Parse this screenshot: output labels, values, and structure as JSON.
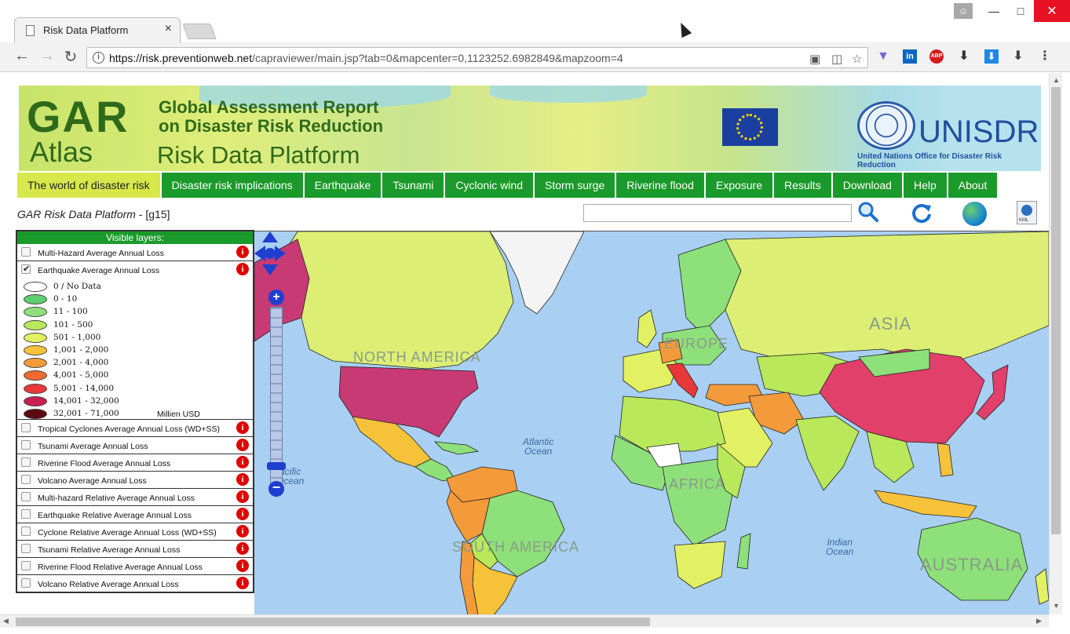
{
  "browser": {
    "tab_title": "Risk Data Platform",
    "tab_close": "×",
    "url_host": "https://risk.preventionweb.net",
    "url_path": "/capraviewer/main.jsp?tab=0&mapcenter=0,1123252.6982849&mapzoom=4",
    "ext_abp": "ABP",
    "ext_in": "in"
  },
  "banner": {
    "logo": "GAR",
    "atlas": "Atlas",
    "report_line1": "Global Assessment Report",
    "report_line2": "on Disaster Risk Reduction",
    "platform": "Risk Data Platform",
    "org": "UNISDR",
    "org_sub": "United Nations Office for Disaster Risk Reduction"
  },
  "menu": [
    {
      "label": "The world of disaster risk",
      "active": true
    },
    {
      "label": "Disaster risk implications"
    },
    {
      "label": "Earthquake"
    },
    {
      "label": "Tsunami"
    },
    {
      "label": "Cyclonic wind"
    },
    {
      "label": "Storm surge"
    },
    {
      "label": "Riverine flood"
    },
    {
      "label": "Exposure"
    },
    {
      "label": "Results"
    },
    {
      "label": "Download"
    },
    {
      "label": "Help"
    },
    {
      "label": "About"
    }
  ],
  "subhead": {
    "title": "GAR Risk Data Platform",
    "suffix": " - [g15]"
  },
  "search": {
    "placeholder": ""
  },
  "layers": {
    "header": "Visible layers:",
    "info_glyph": "i",
    "items": [
      {
        "label": "Multi-Hazard Average Annual Loss",
        "checked": false
      },
      {
        "label": "Earthquake Average Annual Loss",
        "checked": true
      },
      {
        "label": "Tropical Cyclones Average Annual Loss (WD+SS)",
        "checked": false
      },
      {
        "label": "Tsunami Average Annual Loss",
        "checked": false
      },
      {
        "label": "Riverine Flood Average Annual Loss",
        "checked": false
      },
      {
        "label": "Volcano Average Annual Loss",
        "checked": false
      },
      {
        "label": "Multi-hazard Relative Average Annual Loss",
        "checked": false
      },
      {
        "label": "Earthquake Relative Average Annual Loss",
        "checked": false
      },
      {
        "label": "Cyclone Relative Average Annual Loss (WD+SS)",
        "checked": false
      },
      {
        "label": "Tsunami Relative Average Annual Loss",
        "checked": false
      },
      {
        "label": "Riverine Flood Relative Average Annual Loss",
        "checked": false
      },
      {
        "label": "Volcano Relative Average Annual Loss",
        "checked": false
      }
    ],
    "legend": [
      {
        "label": "0 / No Data",
        "color": "#ffffff"
      },
      {
        "label": "0 - 10",
        "color": "#5ccf6e"
      },
      {
        "label": "11 - 100",
        "color": "#8ee07a"
      },
      {
        "label": "101 - 500",
        "color": "#b9e85a"
      },
      {
        "label": "501 - 1,000",
        "color": "#e2f064"
      },
      {
        "label": "1,001 - 2,000",
        "color": "#f6c23a"
      },
      {
        "label": "2,001 - 4,000",
        "color": "#f39a3a"
      },
      {
        "label": "4,001 - 5,000",
        "color": "#ef6a30"
      },
      {
        "label": "5,001 - 14,000",
        "color": "#e8383a"
      },
      {
        "label": "14,001 - 32,000",
        "color": "#c81e50"
      },
      {
        "label": "32,001 - 71,000",
        "color": "#5a0a10"
      }
    ],
    "legend_unit": "Millien USD"
  },
  "map": {
    "labels": {
      "north_america": "NORTH AMERICA",
      "asia": "ASIA",
      "europe": "EUROPE",
      "south_america": "SOUTH AMERICA",
      "africa": "AFRICA",
      "australia": "AUSTRALIA"
    },
    "oceans": {
      "atlantic": "Atlantic\nOcean",
      "pacific": "acific\nOcean",
      "indian": "Indian\nOcean"
    },
    "zoom_plus": "+",
    "zoom_minus": "−"
  },
  "colors": {
    "menu_green": "#1a9a2a",
    "menu_active": "#d6e84a",
    "ocean": "#a9d0f2"
  }
}
